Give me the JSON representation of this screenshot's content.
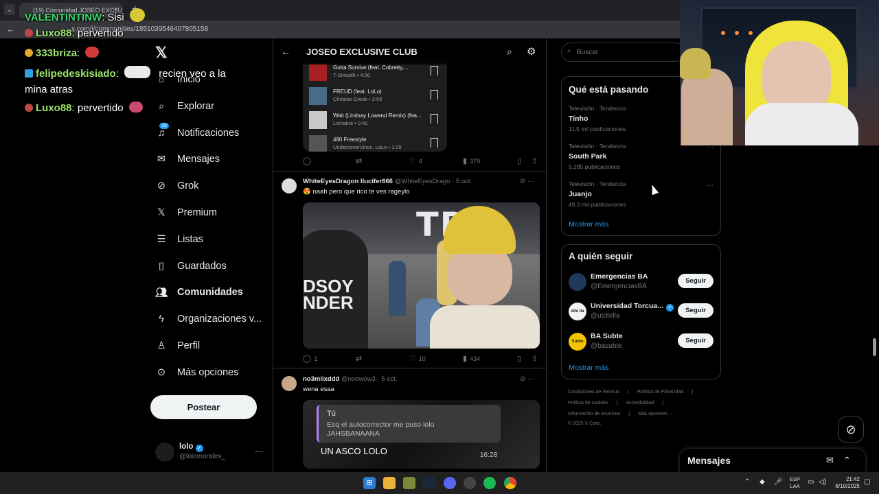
{
  "browser": {
    "tab_title": "(19) Comunidad JOSEO EXCLU...",
    "url": "x.com/i/communities/1851039546407805158"
  },
  "chat": [
    {
      "name": "VALENTINTINW",
      "msg": ": Sisi",
      "color": "#3bd96b"
    },
    {
      "name": "Luxo88",
      "msg": ": pervertido",
      "color": "#9be36b"
    },
    {
      "name": "333briza",
      "msg": ":",
      "color": "#9be36b"
    },
    {
      "name": "felipedeskisiado",
      "msg": ":",
      "msg2": "recien veo a la",
      "msg3": "mina atras",
      "color": "#9be36b"
    },
    {
      "name": "Luxo88",
      "msg": ": pervertido",
      "color": "#9be36b"
    }
  ],
  "nav": {
    "items": [
      {
        "label": "Inicio",
        "icon": "home-icon"
      },
      {
        "label": "Explorar",
        "icon": "search-icon"
      },
      {
        "label": "Notificaciones",
        "icon": "bell-icon",
        "badge": "19"
      },
      {
        "label": "Mensajes",
        "icon": "mail-icon"
      },
      {
        "label": "Grok",
        "icon": "grok-icon"
      },
      {
        "label": "Premium",
        "icon": "x-icon"
      },
      {
        "label": "Listas",
        "icon": "list-icon"
      },
      {
        "label": "Guardados",
        "icon": "bookmark-icon"
      },
      {
        "label": "Comunidades",
        "icon": "people-icon"
      },
      {
        "label": "Organizaciones v...",
        "icon": "lightning-icon"
      },
      {
        "label": "Perfil",
        "icon": "person-icon"
      },
      {
        "label": "Más opciones",
        "icon": "more-circle-icon"
      }
    ],
    "post_button": "Postear",
    "profile": {
      "name": "lolo",
      "handle": "@lolomorales_"
    }
  },
  "main": {
    "title": "JOSEO EXCLUSIVE CLUB",
    "tracks": [
      {
        "title": "Gotta Survive (feat. Cobretty,...",
        "sub": "T-Smooth • 4:36",
        "color": "#a82020"
      },
      {
        "title": "FREUD (feat. LoLo)",
        "sub": "Christos Greek • 2:50",
        "color": "#4a6a8a"
      },
      {
        "title": "Wait (Lindsay Lowend Remix) (fea...",
        "sub": "Lemaitre • 2:42",
        "color": "#c9c9c9"
      },
      {
        "title": "490 Freestyle",
        "sub": "UndercoverVince, LoLo • 1:29",
        "color": "#555"
      }
    ],
    "post1_actions": {
      "replies": "",
      "retweets": "",
      "likes": "4",
      "views": "379"
    },
    "post2": {
      "author": "WhiteEyesDragon llucifer666",
      "handle": "@WhiteEyesDrago",
      "date": "· 5 oct.",
      "text": "😍 naah pero que rico  te ves rageylo",
      "photo_text": "TR",
      "photo_shirt": "DSOY NDER",
      "actions": {
        "replies": "1",
        "retweets": "",
        "likes": "10",
        "views": "434"
      }
    },
    "post3": {
      "author": "no3miixddd",
      "handle": "@noewow3",
      "date": "· 5 oct.",
      "text": "wena esaa",
      "quote_sender": "Tú",
      "quote_text": "Esq el autocorrector me puso lolo JAHSBANAANA",
      "quote_reply": "UN ASCO LOLO",
      "quote_time": "16:28"
    }
  },
  "right": {
    "search_placeholder": "Buscar",
    "trending_title": "Qué está pasando",
    "trends": [
      {
        "category": "Televisión · Tendencia",
        "name": "Tinho",
        "count": "11,5 mil publicaciones"
      },
      {
        "category": "Televisión · Tendencia",
        "name": "South Park",
        "count": "5.285 publicaciones"
      },
      {
        "category": "Televisión · Tendencia",
        "name": "Juanjo",
        "count": "49,3 mil publicaciones"
      }
    ],
    "show_more": "Mostrar más",
    "follow_title": "A quién seguir",
    "follow": [
      {
        "name": "Emergencias BA",
        "handle": "@EmergenciasBA",
        "button": "Seguir",
        "avatar_bg": "#1f3a5a",
        "avatar_text": ""
      },
      {
        "name": "Universidad Torcua...",
        "handle": "@utdtella",
        "button": "Seguir",
        "avatar_bg": "#f2f2f2",
        "avatar_text": "dite lla",
        "verified": true
      },
      {
        "name": "BA Subte",
        "handle": "@basubte",
        "button": "Seguir",
        "avatar_bg": "#f5c400",
        "avatar_text": "Subte"
      }
    ],
    "footer": [
      "Condiciones de Servicio",
      "|",
      "Política de Privacidad",
      "|",
      "Política de cookies",
      "|",
      "Accesibilidad",
      "|",
      "Información de anuncios",
      "|",
      "Más opciones ···",
      "© 2025 X Corp."
    ]
  },
  "dock": {
    "title": "Messages",
    "label": "Mensajes"
  },
  "taskbar": {
    "lang1": "ESP",
    "lang2": "LAA",
    "time": "21:42",
    "date": "6/10/2025"
  }
}
